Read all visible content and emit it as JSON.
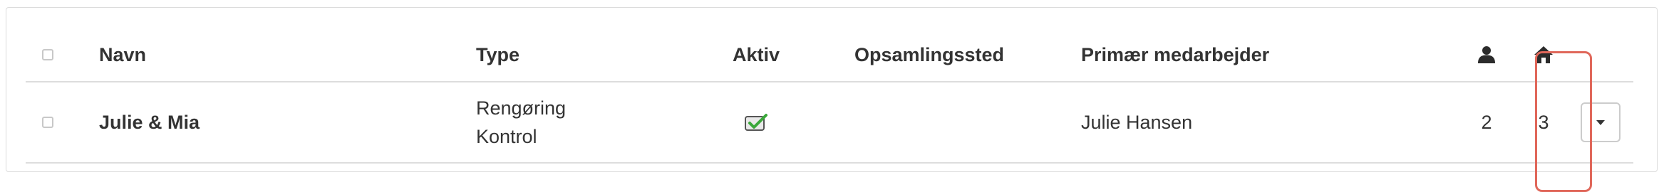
{
  "table": {
    "headers": {
      "name": "Navn",
      "type": "Type",
      "active": "Aktiv",
      "pickup": "Opsamlingssted",
      "primary_employee": "Primær medarbejder",
      "person_icon": "person-icon",
      "house_icon": "house-icon"
    },
    "rows": [
      {
        "name": "Julie & Mia",
        "type_lines": [
          "Rengøring",
          "Kontrol"
        ],
        "active": true,
        "pickup": "",
        "primary_employee": "Julie Hansen",
        "person_count": "2",
        "house_count": "3"
      }
    ]
  },
  "highlight_color": "#e0675a",
  "checkmark_color": "#3aa83a"
}
